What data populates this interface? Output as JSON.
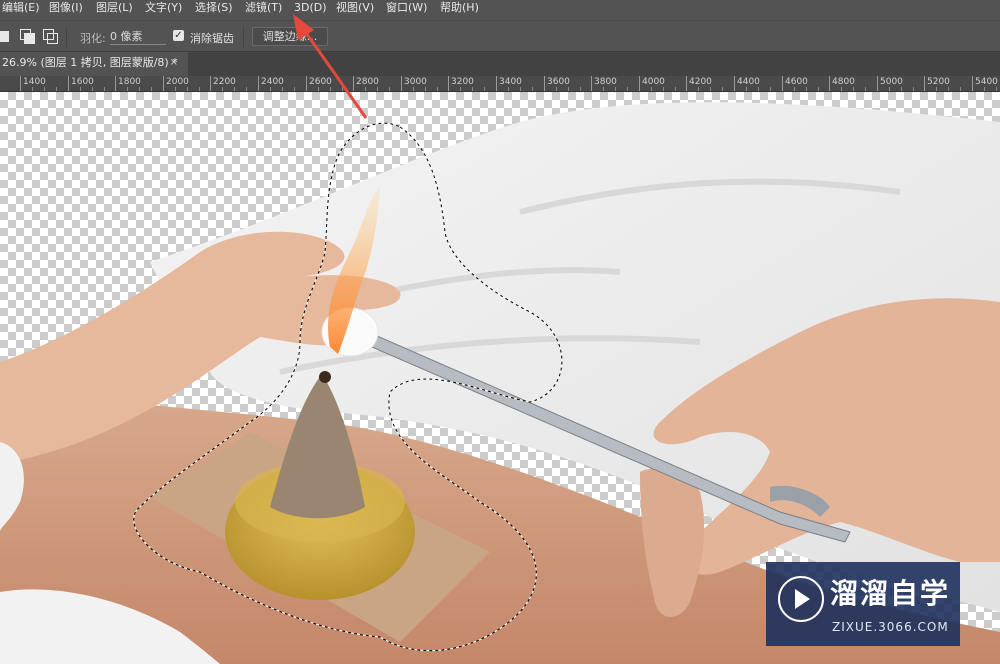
{
  "menu": {
    "items": [
      "编辑(E)",
      "图像(I)",
      "图层(L)",
      "文字(Y)",
      "选择(S)",
      "滤镜(T)",
      "3D(D)",
      "视图(V)",
      "窗口(W)",
      "帮助(H)"
    ]
  },
  "options": {
    "feather_label": "羽化:",
    "feather_value": "0 像素",
    "antialias_label": "消除锯齿",
    "antialias_checked": true,
    "refine_label": "调整边缘..."
  },
  "document": {
    "tab_title": "26.9% (图层 1 拷贝, 图层蒙版/8) *",
    "close_glyph": "×"
  },
  "ruler": {
    "labels": [
      "1400",
      "1600",
      "1800",
      "2000",
      "2200",
      "2400",
      "2600",
      "2800",
      "3000",
      "3200",
      "3400",
      "3600",
      "3800",
      "4000",
      "4200",
      "4400",
      "4600",
      "4800",
      "5000",
      "5200",
      "5400"
    ]
  },
  "watermark": {
    "title": "溜溜自学",
    "subtitle": "ZIXUE.3066.COM"
  },
  "colors": {
    "annotation_arrow": "#e8473c",
    "panel": "#535353",
    "watermark_bg": "#1e305c"
  },
  "icons": {
    "selection_modes": [
      "new-selection-icon",
      "add-to-selection-icon",
      "intersect-selection-icon"
    ],
    "watermark_logo": "play-logo-icon"
  }
}
